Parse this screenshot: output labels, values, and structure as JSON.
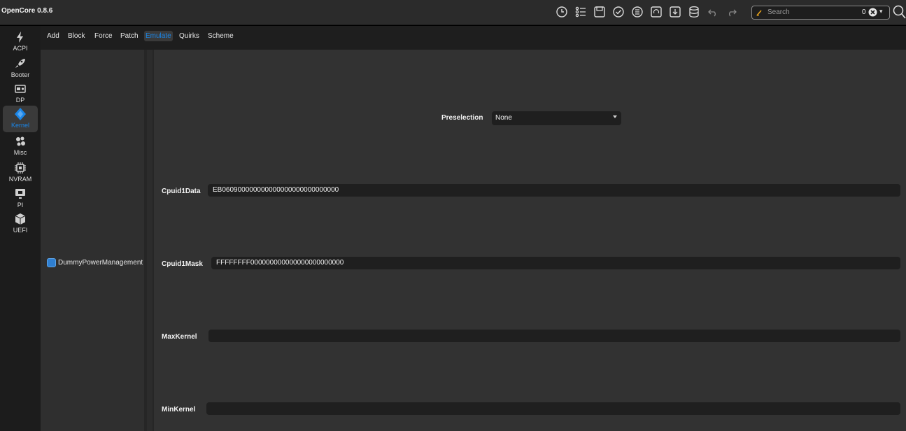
{
  "app": {
    "title": "OpenCore 0.8.6"
  },
  "toolbar": {
    "icons": [
      "history-icon",
      "list-icon",
      "save-icon",
      "check-icon",
      "checklist-icon",
      "refresh-doc-icon",
      "import-icon",
      "database-icon",
      "undo-icon",
      "redo-icon"
    ],
    "search_placeholder": "Search",
    "search_count": "0"
  },
  "sidebar": {
    "items": [
      {
        "label": "ACPI",
        "icon": "bolt-icon"
      },
      {
        "label": "Booter",
        "icon": "rocket-icon"
      },
      {
        "label": "DP",
        "icon": "device-icon"
      },
      {
        "label": "Kernel",
        "icon": "kernel-icon"
      },
      {
        "label": "Misc",
        "icon": "misc-icon"
      },
      {
        "label": "NVRAM",
        "icon": "chip-icon"
      },
      {
        "label": "PI",
        "icon": "monitor-icon"
      },
      {
        "label": "UEFI",
        "icon": "box-icon"
      }
    ],
    "active": "Kernel"
  },
  "tabs": [
    "Add",
    "Block",
    "Force",
    "Patch",
    "Emulate",
    "Quirks",
    "Scheme"
  ],
  "active_tab": "Emulate",
  "list": {
    "entry_label": "DummyPowerManagement",
    "checked": true
  },
  "form": {
    "preselection_label": "Preselection",
    "preselection_value": "None",
    "cpuid1data_label": "Cpuid1Data",
    "cpuid1data_value": "EB060900000000000000000000000000",
    "cpuid1mask_label": "Cpuid1Mask",
    "cpuid1mask_value": "FFFFFFFF000000000000000000000000",
    "maxkernel_label": "MaxKernel",
    "maxkernel_value": "",
    "minkernel_label": "MinKernel",
    "minkernel_value": ""
  },
  "colors": {
    "accent": "#1a86e8",
    "background": "#323232",
    "field": "#1f1f1f"
  }
}
